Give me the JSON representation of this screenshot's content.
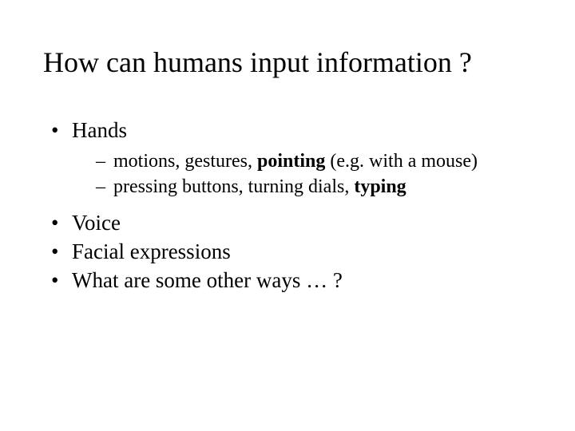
{
  "slide": {
    "title": "How can humans input information ?",
    "bullets": [
      {
        "text": "Hands",
        "sub": [
          {
            "pre": "motions, gestures, ",
            "bold": "pointing",
            "post": " (e.g. with a mouse)"
          },
          {
            "pre": "pressing buttons, turning dials, ",
            "bold": "typing",
            "post": ""
          }
        ]
      },
      {
        "text": "Voice"
      },
      {
        "text": "Facial expressions"
      },
      {
        "text": "What are some other ways … ?"
      }
    ]
  }
}
